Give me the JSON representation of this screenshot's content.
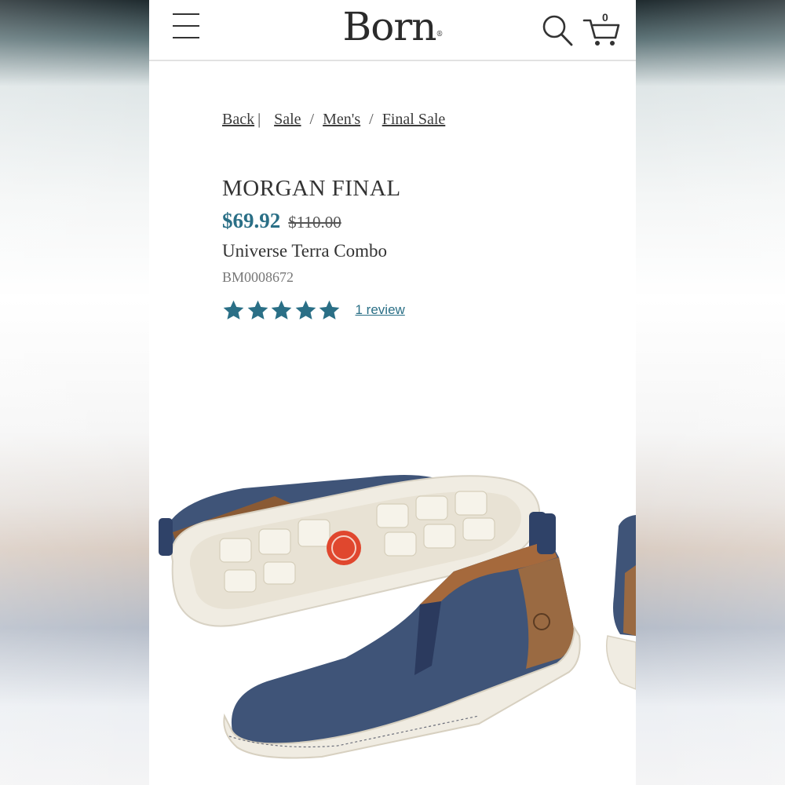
{
  "header": {
    "brand": "Born",
    "cart_count": "0"
  },
  "breadcrumb": {
    "back": "Back",
    "separator": "|",
    "items": [
      "Sale",
      "Men's",
      "Final Sale"
    ],
    "divider": "/"
  },
  "product": {
    "name": "MORGAN FINAL",
    "sale_price": "$69.92",
    "original_price": "$110.00",
    "color": "Universe Terra Combo",
    "sku": "BM0008672",
    "rating": 5,
    "rating_max": 5,
    "review_link": "1 review"
  },
  "icons": {
    "menu": "hamburger-menu-icon",
    "search": "search-icon",
    "cart": "cart-icon",
    "star": "star-icon"
  },
  "colors": {
    "accent": "#2a6f86",
    "text": "#333333",
    "muted": "#777777",
    "shoe_leather": "#3f5478",
    "shoe_heel": "#9a6a42",
    "sole": "#efebe0"
  }
}
